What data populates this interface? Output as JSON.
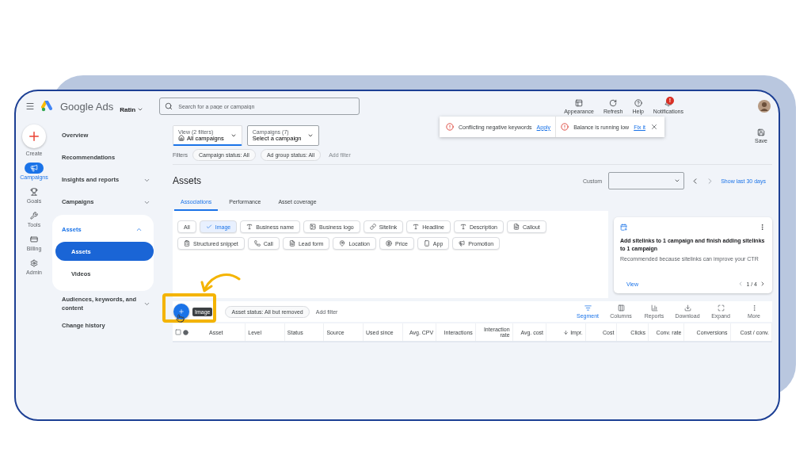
{
  "app": {
    "product": "Google Ads",
    "account": "Ratin",
    "search_placeholder": "Search for a page or campaign"
  },
  "top_actions": [
    {
      "label": "Appearance"
    },
    {
      "label": "Refresh"
    },
    {
      "label": "Help"
    },
    {
      "label": "Notifications",
      "badge": "!"
    }
  ],
  "alerts": [
    {
      "text": "Conflicting negative keywords",
      "link": "Apply"
    },
    {
      "text": "Balance is running low",
      "link": "Fix it"
    }
  ],
  "rail": [
    {
      "label": "Create",
      "kind": "create",
      "selected": false
    },
    {
      "label": "Campaigns",
      "kind": "item",
      "selected": true
    },
    {
      "label": "Goals",
      "kind": "item",
      "selected": false
    },
    {
      "label": "Tools",
      "kind": "item",
      "selected": false
    },
    {
      "label": "Billing",
      "kind": "item",
      "selected": false
    },
    {
      "label": "Admin",
      "kind": "item",
      "selected": false
    }
  ],
  "nav": [
    {
      "label": "Overview"
    },
    {
      "label": "Recommendations"
    },
    {
      "label": "Insights and reports",
      "expanded": false
    },
    {
      "label": "Campaigns",
      "expanded": false
    },
    {
      "label": "Assets",
      "expanded": true,
      "children": [
        {
          "label": "Assets",
          "selected": true
        },
        {
          "label": "Videos",
          "selected": false
        }
      ]
    },
    {
      "label": "Audiences, keywords, and content",
      "expanded": false
    },
    {
      "label": "Change history"
    }
  ],
  "view": {
    "label": "View (2 filters)",
    "value": "All campaigns"
  },
  "campaign_select": {
    "label": "Campaigns (7)",
    "value": "Select a campaign"
  },
  "filters": {
    "label": "Filters",
    "chips": [
      "Campaign status: All",
      "Ad group status: All"
    ],
    "add": "Add filter"
  },
  "save": "Save",
  "page_title": "Assets",
  "date": {
    "label": "Custom",
    "link": "Show last 30 days"
  },
  "tabs": [
    {
      "label": "Associations",
      "selected": true
    },
    {
      "label": "Performance",
      "selected": false
    },
    {
      "label": "Asset coverage",
      "selected": false
    }
  ],
  "type_chips": [
    {
      "label": "All",
      "selected": false
    },
    {
      "label": "Image",
      "selected": true
    },
    {
      "label": "Business name",
      "selected": false
    },
    {
      "label": "Business logo",
      "selected": false
    },
    {
      "label": "Sitelink",
      "selected": false
    },
    {
      "label": "Headline",
      "selected": false
    },
    {
      "label": "Description",
      "selected": false
    },
    {
      "label": "Callout",
      "selected": false
    },
    {
      "label": "Structured snippet",
      "selected": false
    },
    {
      "label": "Call",
      "selected": false
    },
    {
      "label": "Lead form",
      "selected": false
    },
    {
      "label": "Location",
      "selected": false
    },
    {
      "label": "Price",
      "selected": false
    },
    {
      "label": "App",
      "selected": false
    },
    {
      "label": "Promotion",
      "selected": false
    }
  ],
  "recommendation": {
    "title": "Add sitelinks to 1 campaign and finish adding sitelinks to 1 campaign",
    "note": "Recommended because sitelinks can improve your CTR",
    "action": "View",
    "pager": "1 / 4"
  },
  "table_toolbar": {
    "tooltip": "Image",
    "status_chip": "Asset status: All but removed",
    "add": "Add filter",
    "tools": [
      {
        "label": "Segment",
        "selected": true
      },
      {
        "label": "Columns",
        "selected": false
      },
      {
        "label": "Reports",
        "selected": false
      },
      {
        "label": "Download",
        "selected": false
      },
      {
        "label": "Expand",
        "selected": false
      },
      {
        "label": "More",
        "selected": false
      }
    ]
  },
  "columns": [
    {
      "label": "Asset",
      "sorted": false
    },
    {
      "label": "Level",
      "sorted": false
    },
    {
      "label": "Status",
      "sorted": false
    },
    {
      "label": "Source",
      "sorted": false
    },
    {
      "label": "Used since",
      "sorted": false
    },
    {
      "label": "Avg. CPV",
      "sorted": false
    },
    {
      "label": "Interactions",
      "sorted": false
    },
    {
      "label": "Interaction rate",
      "sorted": false
    },
    {
      "label": "Avg. cost",
      "sorted": false
    },
    {
      "label": "Impr.",
      "sorted": true
    },
    {
      "label": "Cost",
      "sorted": false
    },
    {
      "label": "Clicks",
      "sorted": false
    },
    {
      "label": "Conv. rate",
      "sorted": false
    },
    {
      "label": "Conversions",
      "sorted": false
    },
    {
      "label": "Cost / conv.",
      "sorted": false
    }
  ]
}
